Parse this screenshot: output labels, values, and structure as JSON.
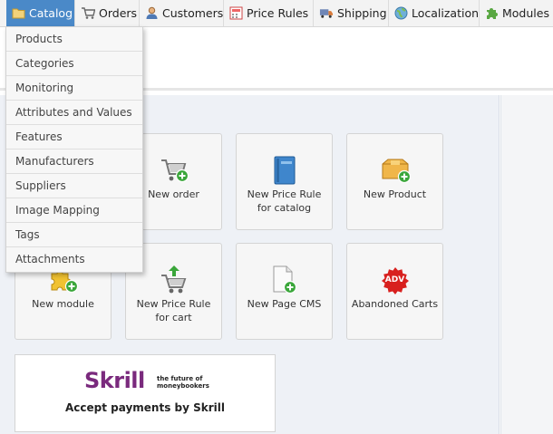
{
  "menu": {
    "tabs": [
      {
        "id": "catalog",
        "label": "Catalog",
        "icon": "folder-icon"
      },
      {
        "id": "orders",
        "label": "Orders",
        "icon": "cart-icon"
      },
      {
        "id": "customers",
        "label": "Customers",
        "icon": "user-icon"
      },
      {
        "id": "price_rules",
        "label": "Price Rules",
        "icon": "calculator-icon"
      },
      {
        "id": "shipping",
        "label": "Shipping",
        "icon": "truck-icon"
      },
      {
        "id": "localization",
        "label": "Localization",
        "icon": "globe-icon"
      },
      {
        "id": "modules",
        "label": "Modules",
        "icon": "puzzle-icon"
      }
    ],
    "active": "catalog"
  },
  "catalog_dropdown": {
    "items": [
      "Products",
      "Categories",
      "Monitoring",
      "Attributes and Values",
      "Features",
      "Manufacturers",
      "Suppliers",
      "Image Mapping",
      "Tags",
      "Attachments"
    ]
  },
  "quick_access": [
    {
      "label": "New order",
      "icon": "cart-add-icon"
    },
    {
      "label": "New Price Rule for catalog",
      "icon": "book-icon"
    },
    {
      "label": "New Product",
      "icon": "box-add-icon"
    },
    {
      "label": "New module",
      "icon": "puzzle-add-icon"
    },
    {
      "label": "New Price Rule for cart",
      "icon": "cart-up-icon"
    },
    {
      "label": "New Page CMS",
      "icon": "page-add-icon"
    },
    {
      "label": "Abandoned Carts",
      "icon": "adv-badge-icon",
      "badge": "ADV"
    }
  ],
  "skrill": {
    "logo": "Skrill",
    "tagline_1": "the future of",
    "tagline_2": "moneybookers",
    "text": "Accept payments by Skrill"
  },
  "colors": {
    "active_tab": "#4a89c8",
    "panel_bg": "#eef1f6",
    "skrill_purple": "#7a2a7d",
    "green_plus": "#3aa63a"
  }
}
